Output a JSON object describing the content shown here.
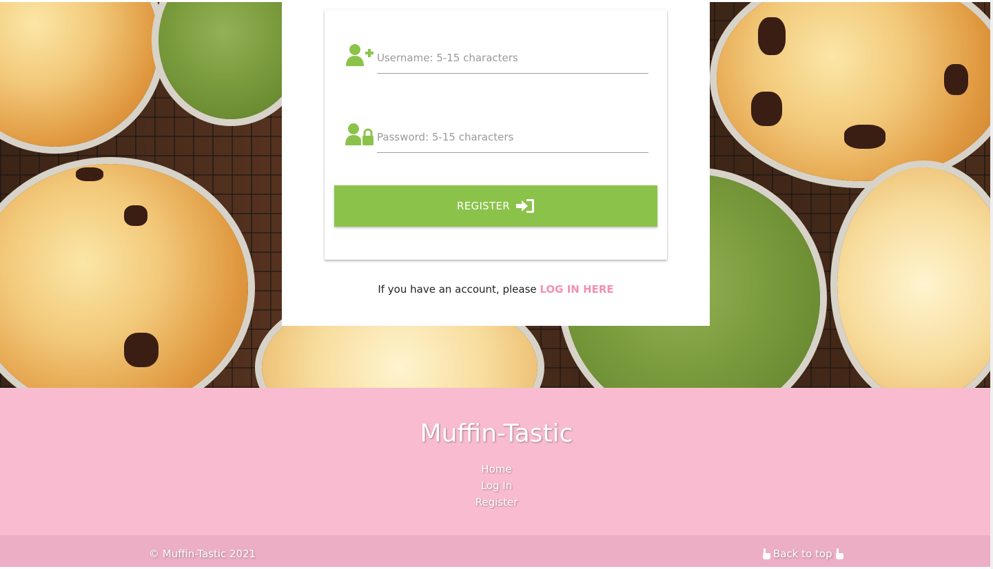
{
  "register_form": {
    "username_placeholder": "Username: 5-15 characters",
    "password_placeholder": "Password: 5-15 characters",
    "register_label": "REGISTER"
  },
  "login_prompt": {
    "text": "If you have an account, please",
    "link_label": "LOG IN HERE"
  },
  "footer": {
    "brand": "Muffin-Tastic",
    "links": [
      "Home",
      "Log In",
      "Register"
    ],
    "copyright": "© Muffin-Tastic 2021",
    "back_to_top": "Back to top"
  },
  "colors": {
    "accent_green": "#8bc34a",
    "link_pink": "#f48fb1",
    "footer_pink": "#f8bbd0",
    "footer_bar_pink": "#ebaec4"
  },
  "icons": {
    "username": "user-plus-icon",
    "password": "user-lock-icon",
    "register": "sign-in-icon",
    "back_to_top": "hand-point-up-icon"
  }
}
